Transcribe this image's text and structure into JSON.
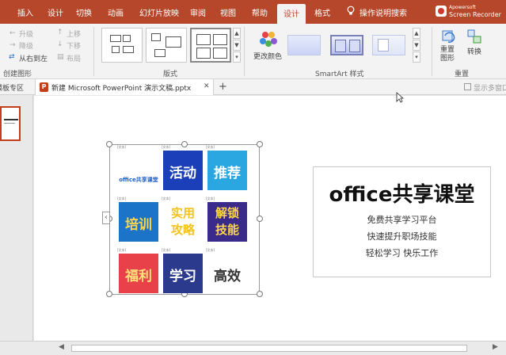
{
  "tabs": [
    "插入",
    "设计",
    "切换",
    "动画",
    "幻灯片放映",
    "审阅",
    "视图",
    "帮助",
    "设计",
    "格式"
  ],
  "tell_me": "操作说明搜索",
  "recorder": {
    "line1": "Apowersoft",
    "line2": "Screen Recorder"
  },
  "ribbon": {
    "create_graphic": {
      "items": [
        "升级",
        "降级",
        "从右到左",
        "上移",
        "下移",
        "布局"
      ],
      "label": "创建图形"
    },
    "layouts": {
      "label": "版式"
    },
    "change_colors": "更改颜色",
    "smartart_styles": {
      "label": "SmartArt 样式"
    },
    "reset": {
      "items": [
        "重置图形",
        "转换"
      ],
      "label": "重置"
    }
  },
  "tabstrip": {
    "left_label": "模板专区",
    "doc_title": "新建 Microsoft PowerPoint 演示文稿.pptx",
    "close": "✕",
    "add": "+",
    "right_label": "显示多窗口"
  },
  "slide": {
    "placeholder_tag": "[文本]",
    "cells": [
      {
        "text": "office共享课堂",
        "bg": "#ffffff",
        "fg": "#1e5dc8"
      },
      {
        "text": "活动",
        "bg": "#1a3fb8",
        "fg": "#ffffff"
      },
      {
        "text": "推荐",
        "bg": "#2aa7e0",
        "fg": "#ffffff"
      },
      {
        "text": "培训",
        "bg": "#1c74c9",
        "fg": "#ffd54a"
      },
      {
        "text": "实用攻略",
        "bg": "#ffffff",
        "fg": "#f3c21c"
      },
      {
        "text": "解锁技能",
        "bg": "#3a2a8a",
        "fg": "#ffd54a"
      },
      {
        "text": "福利",
        "bg": "#e8414a",
        "fg": "#ffe27a"
      },
      {
        "text": "学习",
        "bg": "#2b3a8c",
        "fg": "#ffffff"
      },
      {
        "text": "高效",
        "bg": "#ffffff",
        "fg": "#333333"
      }
    ],
    "expand_arrow": "‹",
    "title": "office共享课堂",
    "lines": [
      "免费共享学习平台",
      "快速提升职场技能",
      "轻松学习 快乐工作"
    ]
  },
  "colors": {
    "accent": "#b7472a",
    "ribbon_bg": "#f3f3f3"
  }
}
